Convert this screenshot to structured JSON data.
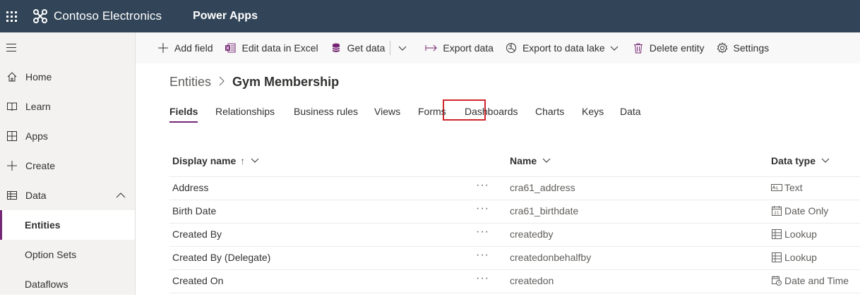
{
  "topbar": {
    "brand": "Contoso Electronics",
    "product": "Power Apps",
    "background_color": "#324558"
  },
  "leftnav": {
    "items": [
      {
        "label": "Home",
        "icon": "home-icon"
      },
      {
        "label": "Learn",
        "icon": "book-icon"
      },
      {
        "label": "Apps",
        "icon": "apps-icon"
      },
      {
        "label": "Create",
        "icon": "plus-icon"
      },
      {
        "label": "Data",
        "icon": "table-icon",
        "expanded": true
      }
    ],
    "subitems": [
      {
        "label": "Entities",
        "active": true
      },
      {
        "label": "Option Sets",
        "active": false
      },
      {
        "label": "Dataflows",
        "active": false
      }
    ],
    "accent_color": "#742774"
  },
  "commandbar": {
    "add_field": "Add field",
    "edit_excel": "Edit data in Excel",
    "get_data": "Get data",
    "export_data": "Export data",
    "export_lake": "Export to data lake",
    "delete_entity": "Delete entity",
    "settings": "Settings"
  },
  "breadcrumb": {
    "root": "Entities",
    "current": "Gym Membership"
  },
  "tabs": [
    {
      "label": "Fields",
      "active": true
    },
    {
      "label": "Relationships",
      "active": false
    },
    {
      "label": "Business rules",
      "active": false
    },
    {
      "label": "Views",
      "active": false
    },
    {
      "label": "Forms",
      "active": false,
      "highlighted": true
    },
    {
      "label": "Dashboards",
      "active": false
    },
    {
      "label": "Charts",
      "active": false
    },
    {
      "label": "Keys",
      "active": false
    },
    {
      "label": "Data",
      "active": false
    }
  ],
  "table": {
    "columns": {
      "display_name": "Display name",
      "sort_indicator": "↑",
      "name": "Name",
      "data_type": "Data type"
    },
    "more_glyph": "···",
    "rows": [
      {
        "display": "Address",
        "name": "cra61_address",
        "type": "Text",
        "type_icon": "text-icon"
      },
      {
        "display": "Birth Date",
        "name": "cra61_birthdate",
        "type": "Date Only",
        "type_icon": "calendar-icon"
      },
      {
        "display": "Created By",
        "name": "createdby",
        "type": "Lookup",
        "type_icon": "lookup-icon"
      },
      {
        "display": "Created By (Delegate)",
        "name": "createdonbehalfby",
        "type": "Lookup",
        "type_icon": "lookup-icon"
      },
      {
        "display": "Created On",
        "name": "createdon",
        "type": "Date and Time",
        "type_icon": "datetime-icon"
      }
    ]
  },
  "highlight_color": "#d1242c"
}
